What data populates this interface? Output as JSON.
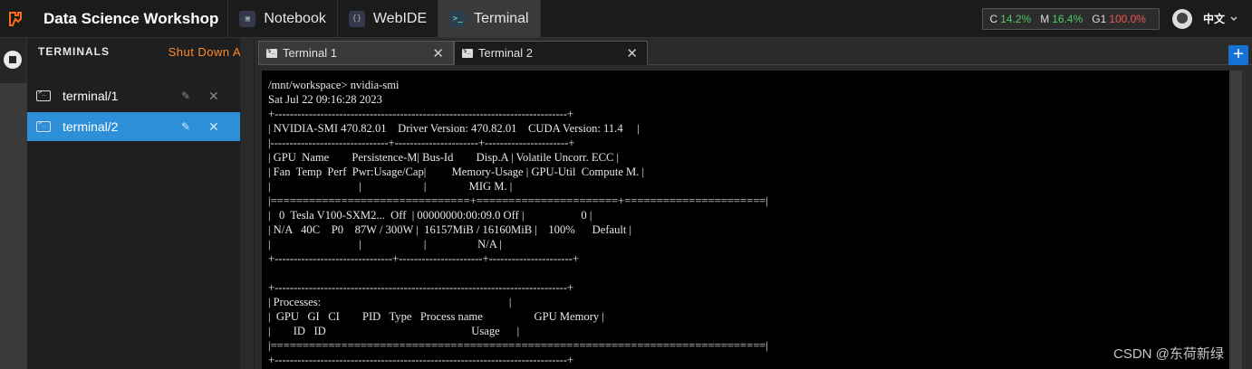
{
  "header": {
    "app_title": "Data Science Workshop",
    "tabs": [
      {
        "label": "Notebook",
        "icon": "notebook-icon"
      },
      {
        "label": "WebIDE",
        "icon": "webide-icon"
      },
      {
        "label": "Terminal",
        "icon": "terminal-icon"
      }
    ],
    "active_tab": "Terminal",
    "stats": {
      "cpu_label": "C",
      "cpu_value": "14.2%",
      "mem_label": "M",
      "mem_value": "16.4%",
      "gpu_label": "G1",
      "gpu_value": "100.0%"
    },
    "language": "中文"
  },
  "panel": {
    "title": "TERMINALS",
    "shutdown_label": "Shut Down All",
    "items": [
      {
        "label": "terminal/1",
        "selected": false
      },
      {
        "label": "terminal/2",
        "selected": true
      }
    ]
  },
  "terminal_tabs": [
    {
      "label": "Terminal 1",
      "active": false
    },
    {
      "label": "Terminal 2",
      "active": true
    }
  ],
  "terminal_output": "/mnt/workspace> nvidia-smi\nSat Jul 22 09:16:28 2023\n+-----------------------------------------------------------------------------+\n| NVIDIA-SMI 470.82.01    Driver Version: 470.82.01    CUDA Version: 11.4     |\n|-------------------------------+----------------------+----------------------+\n| GPU  Name        Persistence-M| Bus-Id        Disp.A | Volatile Uncorr. ECC |\n| Fan  Temp  Perf  Pwr:Usage/Cap|         Memory-Usage | GPU-Util  Compute M. |\n|                               |                      |               MIG M. |\n|===============================+======================+======================|\n|   0  Tesla V100-SXM2...  Off  | 00000000:00:09.0 Off |                    0 |\n| N/A   40C    P0    87W / 300W |  16157MiB / 16160MiB |    100%      Default |\n|                               |                      |                  N/A |\n+-------------------------------+----------------------+----------------------+\n\n+-----------------------------------------------------------------------------+\n| Processes:                                                                  |\n|  GPU   GI   CI        PID   Type   Process name                  GPU Memory |\n|        ID   ID                                                   Usage      |\n|=============================================================================|\n+-----------------------------------------------------------------------------+",
  "watermark": "CSDN @东荷新绿",
  "colors": {
    "accent": "#2d8fd8",
    "add_button": "#1672d4",
    "shutdown": "#ff8a2a",
    "stat_green": "#4fc764",
    "stat_red": "#f05454"
  }
}
